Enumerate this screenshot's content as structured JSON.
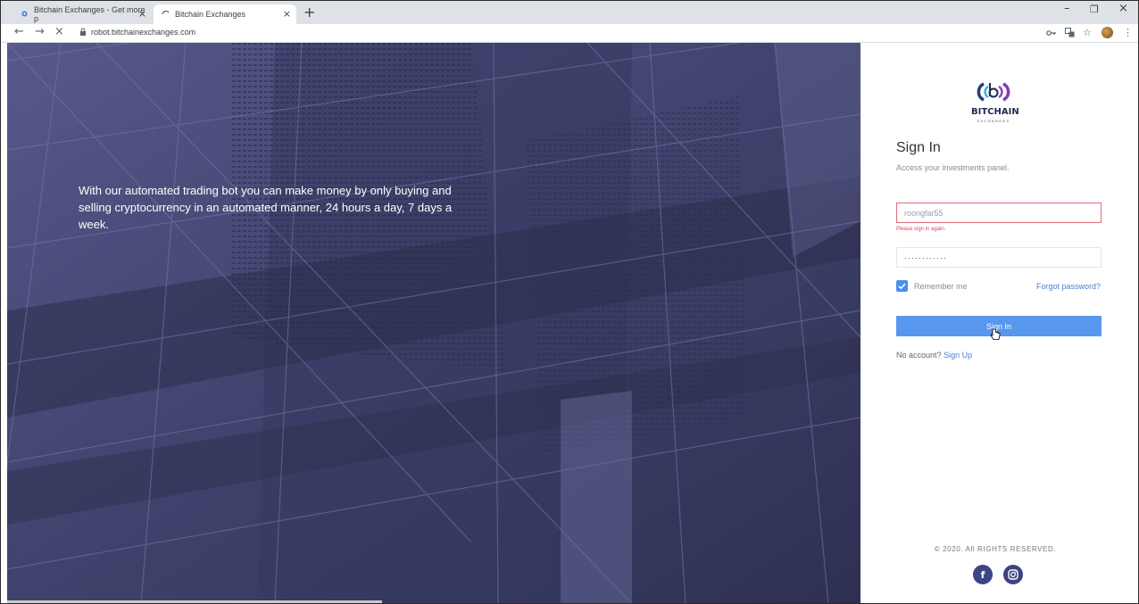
{
  "browser": {
    "tabs": [
      {
        "title": "Bitchain Exchanges - Get more p",
        "active": false
      },
      {
        "title": "Bitchain Exchanges",
        "active": true
      }
    ],
    "new_tab_label": "+",
    "close_glyph": "×",
    "url": "robot.bitchainexchanges.com",
    "icons": {
      "back": "←",
      "forward": "→",
      "stop": "×",
      "lock": "lock-icon",
      "key": "key-icon",
      "translate": "translate-icon",
      "star": "☆",
      "menu": "⋮",
      "minimize": "–",
      "restore": "❐",
      "close": "×"
    }
  },
  "hero": {
    "text": "With our automated trading bot you can make money by only buying and selling cryptocurrency in an automated manner, 24 hours a day, 7 days a week."
  },
  "panel": {
    "brand": "BITCHAIN",
    "brand_sub": "EXCHANGES",
    "title": "Sign In",
    "subtitle": "Access your investments panel.",
    "username_value": "roongfar55",
    "error_text": "Please sign in again.",
    "password_value": "············",
    "remember_label": "Remember me",
    "forgot_label": "Forgot password?",
    "signin_label": "Sign In",
    "no_account_text": "No account?",
    "signup_label": "Sign Up",
    "copyright": "© 2020. All RIGHTS RESERVED.",
    "social": {
      "facebook": "f",
      "instagram": "instagram-icon"
    }
  },
  "colors": {
    "hero_bg": "#4a4d78",
    "accent": "#5897ee",
    "error": "#e0475c",
    "social_bg": "#3c4584"
  }
}
